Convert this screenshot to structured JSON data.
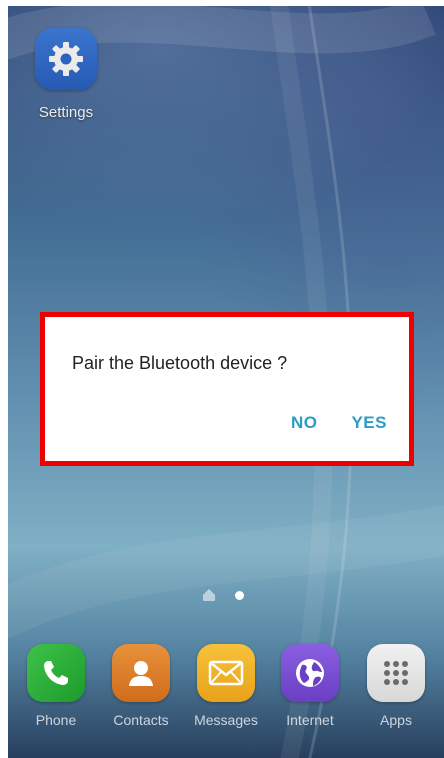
{
  "home": {
    "settings_label": "Settings"
  },
  "dialog": {
    "message": "Pair the Bluetooth device ?",
    "no_label": "NO",
    "yes_label": "YES",
    "highlight_color": "#ee0000",
    "button_color": "#2d9cc2"
  },
  "dock": {
    "items": [
      {
        "label": "Phone",
        "icon": "phone-icon"
      },
      {
        "label": "Contacts",
        "icon": "contacts-icon"
      },
      {
        "label": "Messages",
        "icon": "messages-icon"
      },
      {
        "label": "Internet",
        "icon": "internet-icon"
      },
      {
        "label": "Apps",
        "icon": "apps-grid-icon"
      }
    ]
  }
}
